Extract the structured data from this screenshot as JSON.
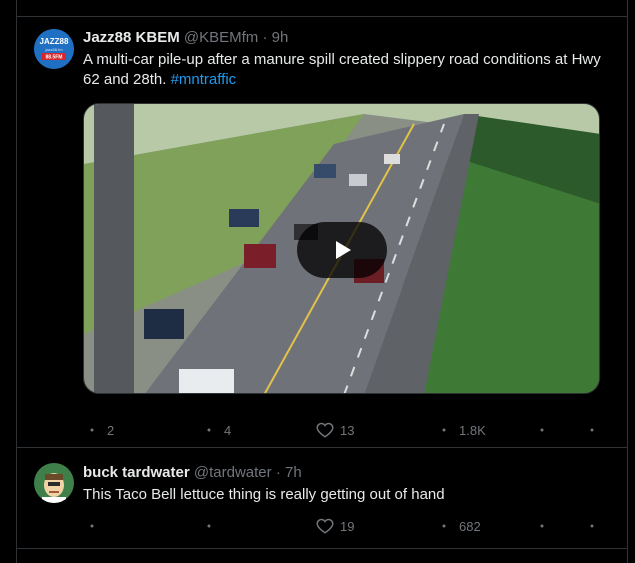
{
  "tweets": [
    {
      "avatar": {
        "label": "JAZZ88",
        "sub": "jazz88.fm",
        "freq": "88.5FM",
        "bg": "#1f6fc2"
      },
      "display_name": "Jazz88 KBEM",
      "handle": "@KBEMfm",
      "time": "9h",
      "text_prefix": "A multi-car pile-up after a manure spill created slippery road conditions at Hwy 62 and 28th. ",
      "hashtag": "#mntraffic",
      "media": {
        "type": "video"
      },
      "metrics": {
        "replies": "2",
        "reposts": "4",
        "likes": "13",
        "views": "1.8K"
      }
    },
    {
      "display_name": "buck tardwater",
      "handle": "@tardwater",
      "time": "7h",
      "text": "This Taco Bell lettuce thing is really getting out of hand",
      "metrics": {
        "likes": "19",
        "views": "682"
      }
    }
  ],
  "colors": {
    "background": "#000000",
    "text": "#e7e9ea",
    "muted": "#71767b",
    "link": "#1d9bf0",
    "border": "#2f3336"
  },
  "icons": [
    "reply-icon",
    "repost-icon",
    "like-icon",
    "views-icon",
    "play-icon"
  ]
}
